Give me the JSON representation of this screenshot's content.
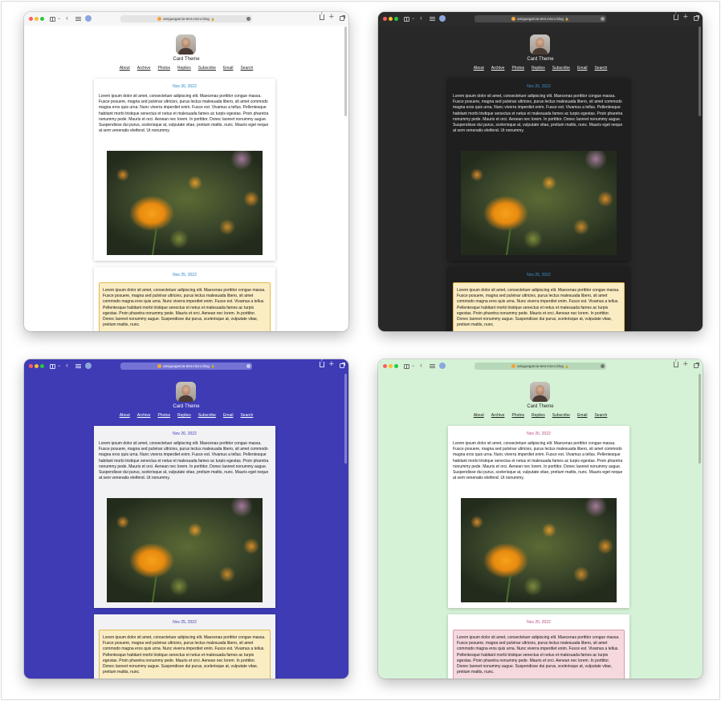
{
  "panels": [
    {
      "theme": "light",
      "url": "amiguegarcia-test.micro.blog",
      "profile": {
        "site_title": "Card Theme"
      },
      "nav": [
        "About",
        "Archive",
        "Photos",
        "Replies",
        "Subscribe",
        "Email",
        "Search"
      ],
      "posts": [
        {
          "date": "Nov 26, 2022",
          "text": "Lorem ipsum dolor sit amet, consectetuer adipiscing elit. Maecenas porttitor congue massa. Fusce posuere, magna sed pulvinar ultricies, purus lectus malesuada libero, sit amet commodo magna eros quis urna. Nunc viverra imperdiet enim. Fusce est. Vivamus a tellus. Pellentesque habitant morbi tristique senectus et netus et malesuada fames ac turpis egestas. Proin pharetra nonummy pede. Mauris et orci. Aenean nec lorem. In porttitor. Donec laoreet nonummy augue. Suspendisse dui purus, scelerisque at, vulputate vitae, pretium mattis, nunc. Mauris eget neque at sem venenatis eleifend. Ut nonummy."
        },
        {
          "date": "Nov 25, 2022",
          "text": "Lorem ipsum dolor sit amet, consectetuer adipiscing elit. Maecenas porttitor congue massa. Fusce posuere, magna sed pulvinar ultricies, purus lectus malesuada libero, sit amet commodo magna eros quis urna. Nunc viverra imperdiet enim. Fusce est. Vivamus a tellus. Pellentesque habitant morbi tristique senectus et netus et malesuada fames ac turpis egestas. Proin pharetra nonummy pede. Mauris et orci. Aenean nec lorem. In porttitor. Donec laoreet nonummy augue. Suspendisse dui purus, scelerisque at, vulputate vitae, pretium mattis, nunc."
        }
      ]
    },
    {
      "theme": "dark",
      "url": "amiguegarcia-test.micro.blog",
      "profile": {
        "site_title": "Card Theme"
      },
      "nav": [
        "About",
        "Archive",
        "Photos",
        "Replies",
        "Subscribe",
        "Email",
        "Search"
      ],
      "posts": [
        {
          "date": "Nov 26, 2022",
          "text": "Lorem ipsum dolor sit amet, consectetuer adipiscing elit. Maecenas porttitor congue massa. Fusce posuere, magna sed pulvinar ultricies, purus lectus malesuada libero, sit amet commodo magna eros quis urna. Nunc viverra imperdiet enim. Fusce est. Vivamus a tellus. Pellentesque habitant morbi tristique senectus et netus et malesuada fames ac turpis egestas. Proin pharetra nonummy pede. Mauris et orci. Aenean nec lorem. In porttitor. Donec laoreet nonummy augue. Suspendisse dui purus, scelerisque at, vulputate vitae, pretium mattis, nunc. Mauris eget neque at sem venenatis eleifend. Ut nonummy."
        },
        {
          "date": "Nov 25, 2022",
          "text": "Lorem ipsum dolor sit amet, consectetuer adipiscing elit. Maecenas porttitor congue massa. Fusce posuere, magna sed pulvinar ultricies, purus lectus malesuada libero, sit amet commodo magna eros quis urna. Nunc viverra imperdiet enim. Fusce est. Vivamus a tellus. Pellentesque habitant morbi tristique senectus et netus et malesuada fames ac turpis egestas. Proin pharetra nonummy pede. Mauris et orci. Aenean nec lorem. In porttitor. Donec laoreet nonummy augue. Suspendisse dui purus, scelerisque at, vulputate vitae, pretium mattis, nunc."
        }
      ]
    },
    {
      "theme": "blue",
      "url": "amiguegarcia-test.micro.blog",
      "profile": {
        "site_title": "Card Theme"
      },
      "nav": [
        "About",
        "Archive",
        "Photos",
        "Replies",
        "Subscribe",
        "Email",
        "Search"
      ],
      "posts": [
        {
          "date": "Nov 26, 2022",
          "text": "Lorem ipsum dolor sit amet, consectetuer adipiscing elit. Maecenas porttitor congue massa. Fusce posuere, magna sed pulvinar ultricies, purus lectus malesuada libero, sit amet commodo magna eros quis urna. Nunc viverra imperdiet enim. Fusce est. Vivamus a tellus. Pellentesque habitant morbi tristique senectus et netus et malesuada fames ac turpis egestas. Proin pharetra nonummy pede. Mauris et orci. Aenean nec lorem. In porttitor. Donec laoreet nonummy augue. Suspendisse dui purus, scelerisque at, vulputate vitae, pretium mattis, nunc. Mauris eget neque at sem venenatis eleifend. Ut nonummy."
        },
        {
          "date": "Nov 25, 2022",
          "text": "Lorem ipsum dolor sit amet, consectetuer adipiscing elit. Maecenas porttitor congue massa. Fusce posuere, magna sed pulvinar ultricies, purus lectus malesuada libero, sit amet commodo magna eros quis urna. Nunc viverra imperdiet enim. Fusce est. Vivamus a tellus. Pellentesque habitant morbi tristique senectus et netus et malesuada fames ac turpis egestas. Proin pharetra nonummy pede. Mauris et orci. Aenean nec lorem. In porttitor. Donec laoreet nonummy augue. Suspendisse dui purus, scelerisque at, vulputate vitae, pretium mattis, nunc."
        }
      ]
    },
    {
      "theme": "green",
      "url": "amiguegarcia-test.micro.blog",
      "profile": {
        "site_title": "Card Theme"
      },
      "nav": [
        "About",
        "Archive",
        "Photos",
        "Replies",
        "Subscribe",
        "Email",
        "Search"
      ],
      "posts": [
        {
          "date": "Nov 26, 2022",
          "text": "Lorem ipsum dolor sit amet, consectetuer adipiscing elit. Maecenas porttitor congue massa. Fusce posuere, magna sed pulvinar ultricies, purus lectus malesuada libero, sit amet commodo magna eros quis urna. Nunc viverra imperdiet enim. Fusce est. Vivamus a tellus. Pellentesque habitant morbi tristique senectus et netus et malesuada fames ac turpis egestas. Proin pharetra nonummy pede. Mauris et orci. Aenean nec lorem. In porttitor. Donec laoreet nonummy augue. Suspendisse dui purus, scelerisque at, vulputate vitae, pretium mattis, nunc. Mauris eget neque at sem venenatis eleifend. Ut nonummy."
        },
        {
          "date": "Nov 25, 2022",
          "text": "Lorem ipsum dolor sit amet, consectetuer adipiscing elit. Maecenas porttitor congue massa. Fusce posuere, magna sed pulvinar ultricies, purus lectus malesuada libero, sit amet commodo magna eros quis urna. Nunc viverra imperdiet enim. Fusce est. Vivamus a tellus. Pellentesque habitant morbi tristique senectus et netus et malesuada fames ac turpis egestas. Proin pharetra nonummy pede. Mauris et orci. Aenean nec lorem. In porttitor. Donec laoreet nonummy augue. Suspendisse dui purus, scelerisque at, vulputate vitae, pretium mattis, nunc."
        }
      ]
    }
  ]
}
